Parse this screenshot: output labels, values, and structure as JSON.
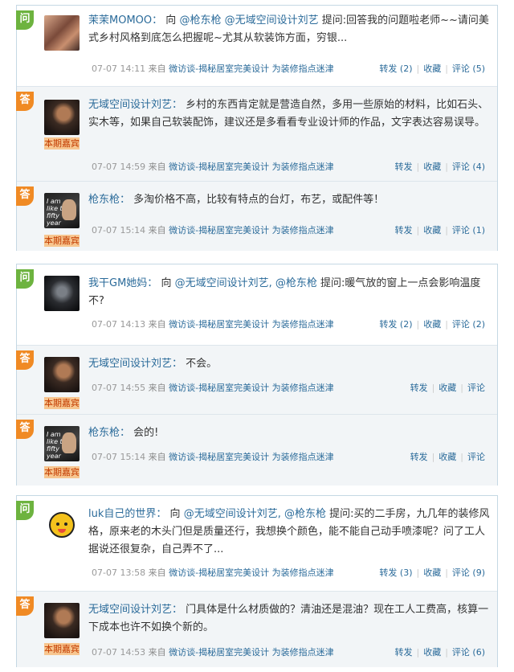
{
  "labels": {
    "question_badge": "问",
    "answer_badge": "答",
    "guest_tag": "本期嘉宾",
    "source_prefix": "来自",
    "source_name": "微访谈-揭秘居室完美设计",
    "link_text": "为装修指点迷津"
  },
  "posts": {
    "p1": {
      "user": "茉茉MOMOO：",
      "to": "向",
      "mention1": "@枪东枪",
      "mention2": "@无域空间设计刘艺",
      "body": "提问:回答我的问题啦老师~~请问美式乡村风格到底怎么把握呢~尤其从软装饰方面，穷银...",
      "time": "07-07 14:11",
      "forward": "转发 (2)",
      "fav": "收藏",
      "comment": "评论 (5)"
    },
    "p2": {
      "user": "无域空间设计刘艺：",
      "body": "乡村的东西肯定就是营造自然，多用一些原始的材料，比如石头、实木等，如果自己软装配饰，建议还是多看看专业设计师的作品，文字表达容易误导。",
      "time": "07-07 14:59",
      "forward": "转发",
      "fav": "收藏",
      "comment": "评论 (4)"
    },
    "p3": {
      "user": "枪东枪：",
      "body": "多淘价格不高，比较有特点的台灯，布艺，或配件等！",
      "time": "07-07 15:14",
      "forward": "转发",
      "fav": "收藏",
      "comment": "评论 (1)"
    },
    "p4": {
      "user": "我干GM她妈：",
      "to": "向",
      "mention1": "@无域空间设计刘艺,",
      "mention2": "@枪东枪",
      "body": "提问:暖气放的窗上一点会影响温度不?",
      "time": "07-07 14:13",
      "forward": "转发 (2)",
      "fav": "收藏",
      "comment": "评论 (2)"
    },
    "p5": {
      "user": "无域空间设计刘艺：",
      "body": "不会。",
      "time": "07-07 14:55",
      "forward": "转发",
      "fav": "收藏",
      "comment": "评论"
    },
    "p6": {
      "user": "枪东枪：",
      "body": "会的!",
      "time": "07-07 15:14",
      "forward": "转发",
      "fav": "收藏",
      "comment": "评论"
    },
    "p7": {
      "user": "luk自己的世界：",
      "to": "向",
      "mention1": "@无域空间设计刘艺,",
      "mention2": "@枪东枪",
      "body": "提问:买的二手房，九几年的装修风格，原来老的木头门但是质量还行，我想换个颜色，能不能自己动手喷漆呢？问了工人据说还很复杂，自己弄不了...",
      "time": "07-07 13:58",
      "forward": "转发 (3)",
      "fav": "收藏",
      "comment": "评论 (9)"
    },
    "p8": {
      "user": "无域空间设计刘艺：",
      "body": "门具体是什么材质做的？清油还是混油？现在工人工费高，核算一下成本也许不如换个新的。",
      "time": "07-07 14:53",
      "forward": "转发",
      "fav": "收藏",
      "comment": "评论 (6)"
    }
  },
  "colors": {
    "question_badge": "#6db33f",
    "answer_badge": "#f08a24",
    "link_blue": "#2b6b9a",
    "guest_tag_bg": "#f7c690"
  },
  "avatar_icons": {
    "p1": "user-photo-icon",
    "p2": "guest-photo-icon",
    "p3": "guest-photo-icon",
    "p4": "user-photo-icon",
    "p7": "tiger-cartoon-icon"
  }
}
